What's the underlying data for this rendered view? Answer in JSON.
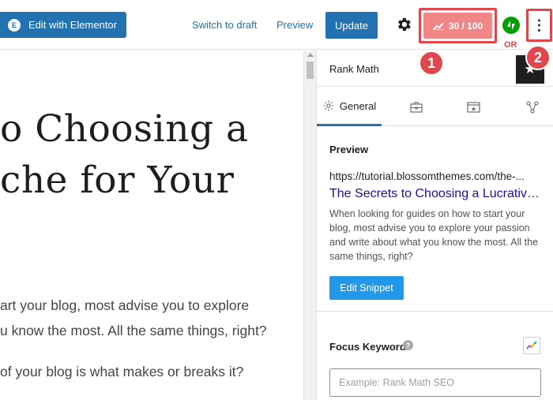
{
  "toolbar": {
    "elementor_label": "Edit with Elementor",
    "elementor_icon": "E",
    "switch_draft_label": "Switch to draft",
    "preview_label": "Preview",
    "update_label": "Update",
    "seo_score": "30 / 100",
    "or_label": "OR",
    "more_menu_glyph": "⋮"
  },
  "annotations": {
    "badge_1": "1",
    "badge_2": "2"
  },
  "editor": {
    "heading_line1": "o Choosing a",
    "heading_line2": "che for Your",
    "para_line1": "art your blog, most advise you to explore",
    "para_line2": "u know the most. All the same things, right?",
    "para_line3": "of your blog is what makes or breaks it?"
  },
  "sidebar": {
    "title": "Rank Math",
    "tabs": [
      {
        "label": "General",
        "icon": "gear-icon"
      },
      {
        "label": "",
        "icon": "briefcase-icon"
      },
      {
        "label": "",
        "icon": "schema-icon"
      },
      {
        "label": "",
        "icon": "social-share-icon"
      }
    ],
    "preview": {
      "title": "Preview",
      "url": "https://tutorial.blossomthemes.com/the-...",
      "serp_title": "The Secrets to Choosing a Lucrative Niche for Your Blog",
      "description": "When looking for guides on how to start your blog, most advise you to explore your passion and write about what you know the most. All the same things, right?",
      "edit_snippet_label": "Edit Snippet"
    },
    "focus_keyword": {
      "label": "Focus Keyword",
      "placeholder": "Example: Rank Math SEO"
    }
  },
  "colors": {
    "accent": "#2271b1",
    "score_bg": "#f08686",
    "highlight": "#e0474c",
    "serp_title": "#1a0dab",
    "button_blue": "#2199e8"
  }
}
